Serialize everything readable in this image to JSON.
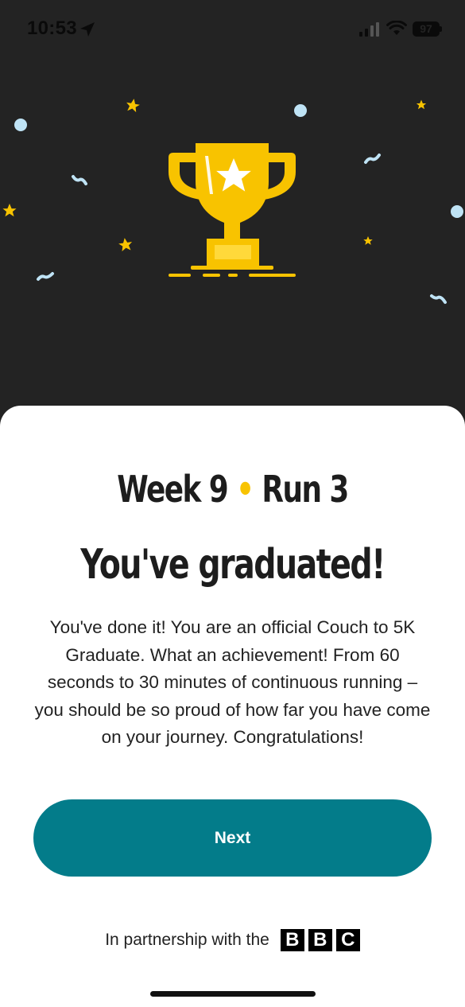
{
  "status_bar": {
    "time": "10:53",
    "battery": "97"
  },
  "sheet": {
    "week_label": "Week 9",
    "run_label": "Run 3",
    "separator": "•",
    "title": "You've graduated!",
    "body": "You've done it! You are an official Couch to 5K Graduate. What an achievement! From 60 seconds to 30 minutes of continuous running – you should be so proud of how far you have come on your journey. Congratulations!",
    "next_label": "Next",
    "partnership_text": "In partnership with the",
    "bbc_letters": [
      "B",
      "B",
      "C"
    ]
  },
  "colors": {
    "hero_background": "#232323",
    "trophy": "#f8c300",
    "accent_dot": "#f8c300",
    "button": "#037c8a",
    "confetti_blue": "#bfe3f5"
  },
  "icons": [
    "location-arrow-icon",
    "signal-icon",
    "wifi-icon",
    "trophy-icon",
    "star-icon"
  ]
}
